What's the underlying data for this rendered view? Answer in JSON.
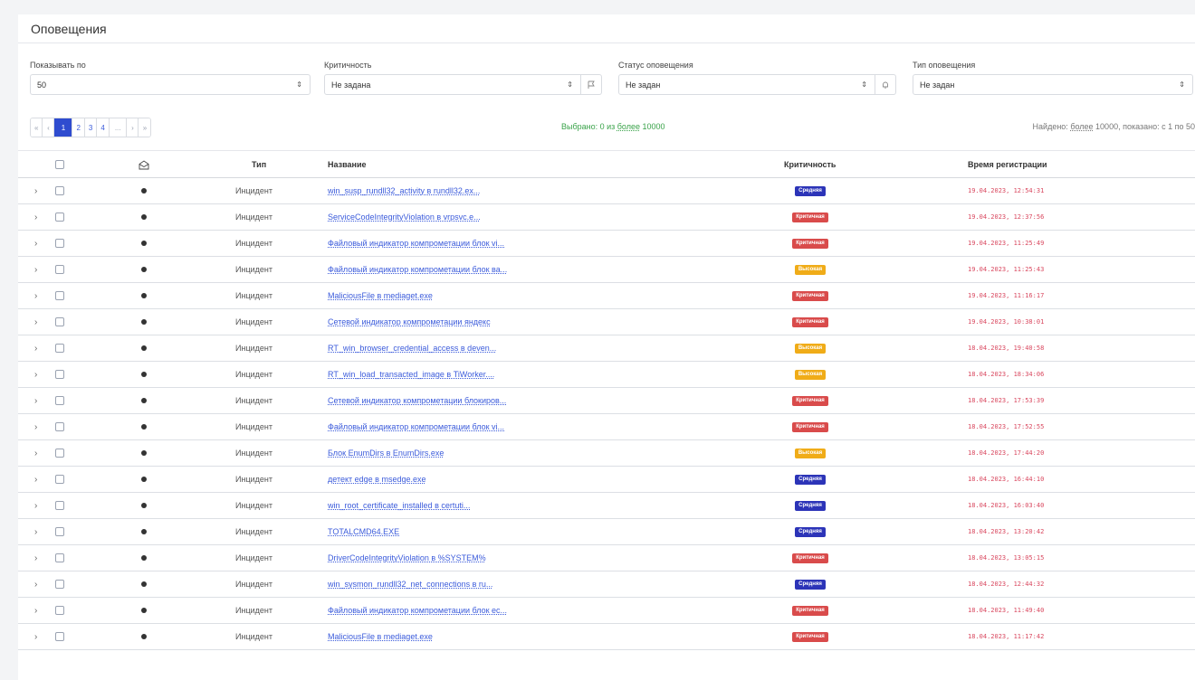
{
  "page": {
    "title": "Оповещения"
  },
  "filters": [
    {
      "label": "Показывать по",
      "value": "50"
    },
    {
      "label": "Критичность",
      "value": "Не задана",
      "button_icon": "flag-icon"
    },
    {
      "label": "Статус оповещения",
      "value": "Не задан",
      "button_icon": "bell-icon"
    },
    {
      "label": "Тип оповещения",
      "value": "Не задан"
    }
  ],
  "pagination": {
    "first": "«",
    "prev": "‹",
    "pages": [
      "1",
      "2",
      "3",
      "4"
    ],
    "ellipsis": "...",
    "next": "›",
    "last": "»",
    "active": "1"
  },
  "selected": {
    "prefix": "Выбрано: 0 из ",
    "total": "более",
    "suffix": " 10000"
  },
  "found": {
    "prefix": "Найдено: ",
    "total": "более",
    "suffix": " 10000, показано: с 1 по 50"
  },
  "columns": {
    "type": "Тип",
    "name": "Название",
    "criticality": "Критичность",
    "time": "Время регистрации",
    "read_icon": "envelope-open-icon"
  },
  "colors": {
    "accent": "#2f4ccf",
    "link": "#3b5bdb",
    "time": "#d9485f",
    "critical": "#d94b4b",
    "high": "#f0ac18",
    "medium": "#2c34b8"
  },
  "criticality_colors": {
    "Средняя": "#2c34b8",
    "Критичная": "#d94b4b",
    "Высокая": "#f0ac18"
  },
  "rows": [
    {
      "type": "Инцидент",
      "name": "win_susp_rundll32_activity в rundll32.ex...",
      "criticality": "Средняя",
      "time": "19.04.2023, 12:54:31"
    },
    {
      "type": "Инцидент",
      "name": "ServiceCodeIntegrityViolation в vrpsvc.e...",
      "criticality": "Критичная",
      "time": "19.04.2023, 12:37:56"
    },
    {
      "type": "Инцидент",
      "name": "Файловый индикатор компрометации блок vi...",
      "criticality": "Критичная",
      "time": "19.04.2023, 11:25:49"
    },
    {
      "type": "Инцидент",
      "name": "Файловый индикатор компрометации блок ва...",
      "criticality": "Высокая",
      "time": "19.04.2023, 11:25:43"
    },
    {
      "type": "Инцидент",
      "name": "MaliciousFile в mediaget.exe",
      "criticality": "Критичная",
      "time": "19.04.2023, 11:16:17"
    },
    {
      "type": "Инцидент",
      "name": "Сетевой индикатор компрометации яндекс",
      "criticality": "Критичная",
      "time": "19.04.2023, 10:38:01"
    },
    {
      "type": "Инцидент",
      "name": "RT_win_browser_credential_access в deven...",
      "criticality": "Высокая",
      "time": "18.04.2023, 19:40:58"
    },
    {
      "type": "Инцидент",
      "name": "RT_win_load_transacted_image в TiWorker....",
      "criticality": "Высокая",
      "time": "18.04.2023, 18:34:06"
    },
    {
      "type": "Инцидент",
      "name": "Сетевой индикатор компрометации блокиров...",
      "criticality": "Критичная",
      "time": "18.04.2023, 17:53:39"
    },
    {
      "type": "Инцидент",
      "name": "Файловый индикатор компрометации блок vi...",
      "criticality": "Критичная",
      "time": "18.04.2023, 17:52:55"
    },
    {
      "type": "Инцидент",
      "name": "Блок EnumDirs в EnumDirs.exe",
      "criticality": "Высокая",
      "time": "18.04.2023, 17:44:20"
    },
    {
      "type": "Инцидент",
      "name": "детект edge в msedge.exe",
      "criticality": "Средняя",
      "time": "18.04.2023, 16:44:10"
    },
    {
      "type": "Инцидент",
      "name": "win_root_certificate_installed в certuti...",
      "criticality": "Средняя",
      "time": "18.04.2023, 16:03:40"
    },
    {
      "type": "Инцидент",
      "name": "TOTALCMD64.EXE",
      "criticality": "Средняя",
      "time": "18.04.2023, 13:20:42"
    },
    {
      "type": "Инцидент",
      "name": "DriverCodeIntegrityViolation в %SYSTEM%",
      "criticality": "Критичная",
      "time": "18.04.2023, 13:05:15"
    },
    {
      "type": "Инцидент",
      "name": "win_sysmon_rundll32_net_connections в ru...",
      "criticality": "Средняя",
      "time": "18.04.2023, 12:44:32"
    },
    {
      "type": "Инцидент",
      "name": "Файловый индикатор компрометации блок ec...",
      "criticality": "Критичная",
      "time": "18.04.2023, 11:49:40"
    },
    {
      "type": "Инцидент",
      "name": "MaliciousFile в mediaget.exe",
      "criticality": "Критичная",
      "time": "18.04.2023, 11:17:42"
    }
  ]
}
